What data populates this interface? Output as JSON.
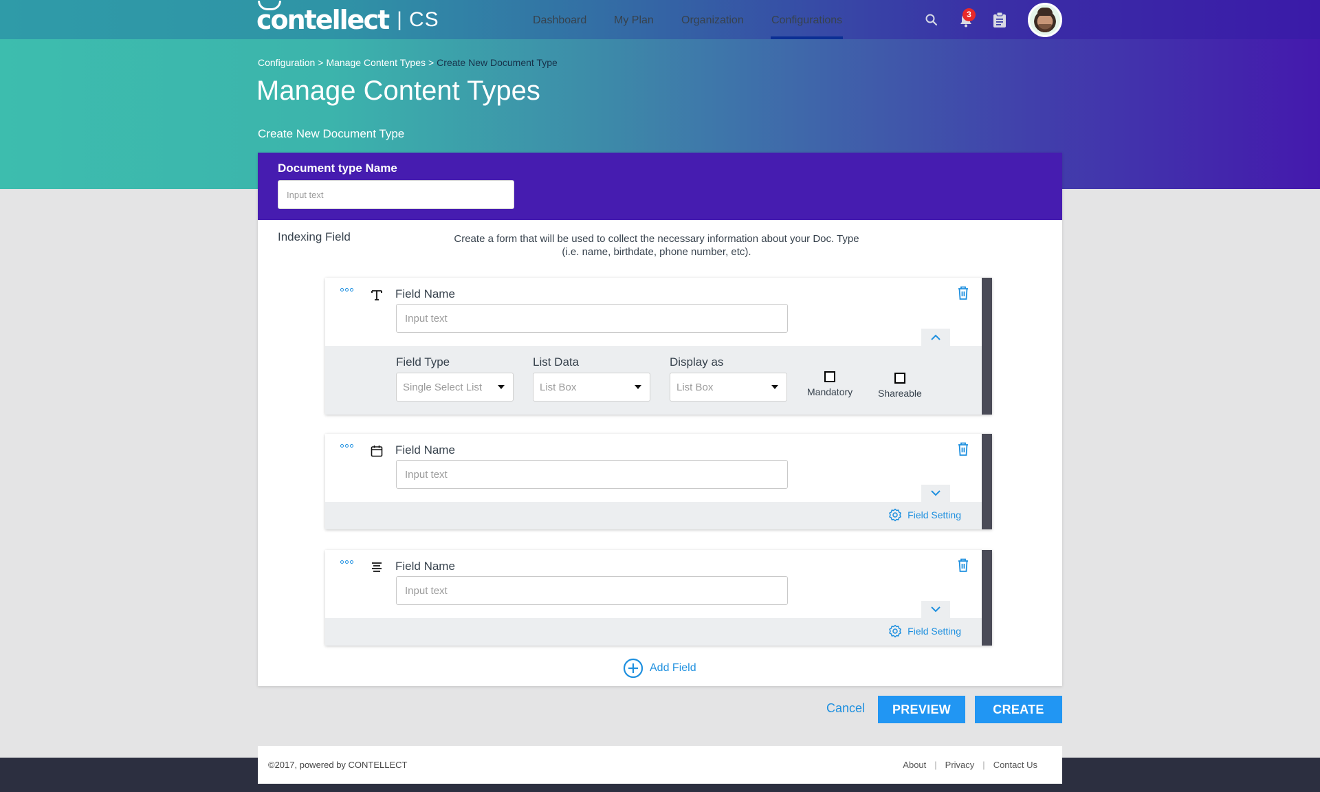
{
  "header": {
    "logo_text": "contellect",
    "logo_separator": "|",
    "product": "CS",
    "nav": [
      {
        "label": "Dashboard",
        "active": false
      },
      {
        "label": "My Plan",
        "active": false
      },
      {
        "label": "Organization",
        "active": false
      },
      {
        "label": "Configurations",
        "active": true
      }
    ],
    "icons": [
      "search-icon",
      "bell-icon",
      "clipboard-icon",
      "avatar"
    ],
    "notification_count": "3"
  },
  "breadcrumb": [
    {
      "label": "Configuration"
    },
    {
      "label": ">"
    },
    {
      "label": "Manage Content Types"
    },
    {
      "label": ">"
    },
    {
      "label": "Create New Document Type"
    }
  ],
  "page": {
    "title": "Manage Content Types",
    "subtitle": "Create New Document Type"
  },
  "form": {
    "doc_type_label": "Document type Name",
    "doc_type_placeholder": "Input text",
    "doc_type_value": "",
    "indexing_label": "Indexing Field",
    "indexing_desc_line1": "Create a form that will be used to collect the necessary information about your Doc. Type",
    "indexing_desc_line2": "(i.e. name, birthdate, phone number, etc).",
    "fields": [
      {
        "type_icon": "text-icon",
        "label": "Field Name",
        "placeholder": "Input text",
        "expanded": true,
        "field_type_label": "Field Type",
        "field_type_value": "Single Select List",
        "list_data_label": "List Data",
        "list_data_value": "List Box",
        "display_as_label": "Display as",
        "display_as_value": "List Box",
        "mandatory_label": "Mandatory",
        "mandatory_checked": false,
        "shareable_label": "Shareable",
        "shareable_checked": false
      },
      {
        "type_icon": "calendar-icon",
        "label": "Field Name",
        "placeholder": "Input text",
        "expanded": false,
        "setting_label": "Field Setting"
      },
      {
        "type_icon": "paragraph-icon",
        "label": "Field Name",
        "placeholder": "Input text",
        "expanded": false,
        "setting_label": "Field Setting"
      }
    ],
    "add_field_label": "Add Field"
  },
  "actions": {
    "cancel": "Cancel",
    "preview": "PREVIEW",
    "create": "CREATE"
  },
  "footer": {
    "copyright": "©2017, powered by CONTELLECT",
    "links": [
      "About",
      "Privacy",
      "Contact Us"
    ],
    "separator": "|"
  },
  "colors": {
    "accent": "#2196f3",
    "panel_header": "#461cb0",
    "hero_start": "#3dbdae",
    "hero_end": "#4419ad",
    "badge": "#e82a2a",
    "footer_band": "#2c2f40"
  }
}
